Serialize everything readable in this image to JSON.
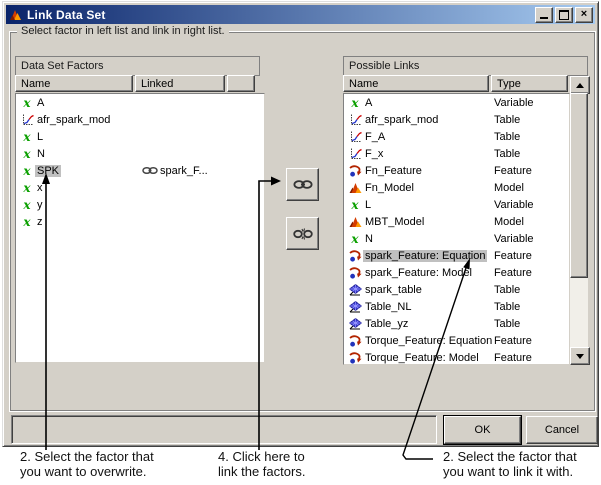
{
  "window": {
    "title": "Link Data Set",
    "controls": {
      "minimize": "minimize",
      "maximize": "maximize",
      "close": "close"
    }
  },
  "groupbox_label": "Select factor in left list and link in right list.",
  "left_panel": {
    "title": "Data Set Factors",
    "columns": {
      "name": "Name",
      "linked": "Linked"
    },
    "rows": [
      {
        "icon": "variable",
        "name": "A",
        "linked": ""
      },
      {
        "icon": "table2d",
        "name": "afr_spark_mod",
        "linked": ""
      },
      {
        "icon": "variable",
        "name": "L",
        "linked": ""
      },
      {
        "icon": "variable",
        "name": "N",
        "linked": ""
      },
      {
        "icon": "variable",
        "name": "SPK",
        "linked": "spark_F...",
        "selected": true
      },
      {
        "icon": "variable",
        "name": "x",
        "linked": ""
      },
      {
        "icon": "variable",
        "name": "y",
        "linked": ""
      },
      {
        "icon": "variable",
        "name": "z",
        "linked": ""
      }
    ]
  },
  "right_panel": {
    "title": "Possible Links",
    "columns": {
      "name": "Name",
      "type": "Type"
    },
    "rows": [
      {
        "icon": "variable",
        "name": "A",
        "type": "Variable"
      },
      {
        "icon": "table2d",
        "name": "afr_spark_mod",
        "type": "Table"
      },
      {
        "icon": "table2d",
        "name": "F_A",
        "type": "Table"
      },
      {
        "icon": "table2d",
        "name": "F_x",
        "type": "Table"
      },
      {
        "icon": "feature",
        "name": "Fn_Feature",
        "type": "Feature"
      },
      {
        "icon": "model",
        "name": "Fn_Model",
        "type": "Model"
      },
      {
        "icon": "variable",
        "name": "L",
        "type": "Variable"
      },
      {
        "icon": "model",
        "name": "MBT_Model",
        "type": "Model"
      },
      {
        "icon": "variable",
        "name": "N",
        "type": "Variable"
      },
      {
        "icon": "feature",
        "name": "spark_Feature: Equation",
        "type": "Feature",
        "selected": true
      },
      {
        "icon": "feature",
        "name": "spark_Feature: Model",
        "type": "Feature"
      },
      {
        "icon": "table3d",
        "name": "spark_table",
        "type": "Table"
      },
      {
        "icon": "table3d",
        "name": "Table_NL",
        "type": "Table"
      },
      {
        "icon": "table3d",
        "name": "Table_yz",
        "type": "Table"
      },
      {
        "icon": "feature",
        "name": "Torque_Feature: Equation",
        "type": "Feature"
      },
      {
        "icon": "feature",
        "name": "Torque_Feature: Model",
        "type": "Feature"
      }
    ]
  },
  "buttons": {
    "ok": "OK",
    "cancel": "Cancel"
  },
  "annotations": {
    "left": {
      "line1": "2. Select the factor that",
      "line2": "you want to overwrite."
    },
    "middle": {
      "line1": "4. Click here to",
      "line2": "link the factors."
    },
    "right": {
      "line1": "2. Select the factor that",
      "line2": "you want to link it with."
    }
  },
  "colors": {
    "dialog_bg": "#d4d0c8",
    "titlebar_left": "#0a246a",
    "titlebar_right": "#a6caf0",
    "selection_bg": "#c0c0c0",
    "variable_green": "#0ba000",
    "list_bg": "#ffffff"
  }
}
